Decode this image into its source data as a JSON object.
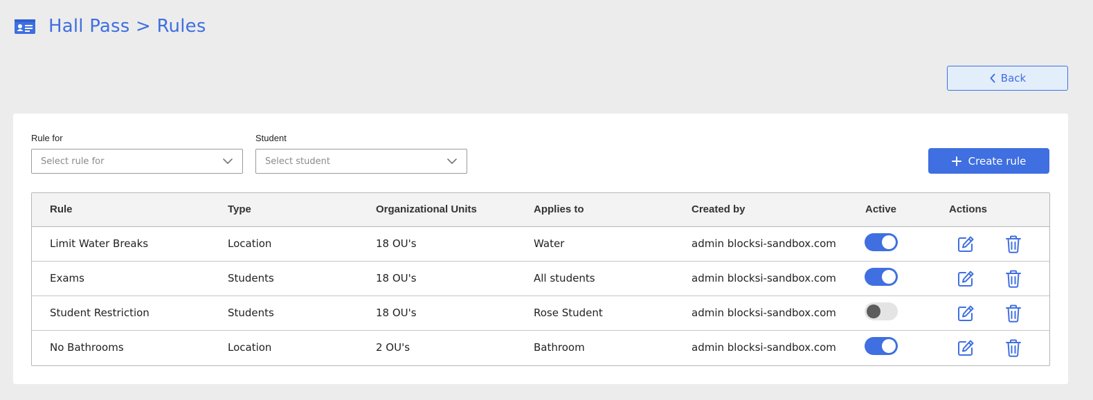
{
  "header": {
    "icon": "id-card-icon",
    "title": "Hall Pass > Rules"
  },
  "back_button": {
    "icon": "chevron-left-icon",
    "label": "Back"
  },
  "filters": {
    "rule_for": {
      "label": "Rule for",
      "placeholder": "Select rule for"
    },
    "student": {
      "label": "Student",
      "placeholder": "Select student"
    }
  },
  "create_button": {
    "icon": "plus-icon",
    "label": "Create rule"
  },
  "table": {
    "columns": [
      "Rule",
      "Type",
      "Organizational Units",
      "Applies to",
      "Created by",
      "Active",
      "Actions"
    ],
    "rows": [
      {
        "rule": "Limit Water Breaks",
        "type": "Location",
        "ous": "18 OU's",
        "applies_to": "Water",
        "created_by": "admin blocksi-sandbox.com",
        "active": true
      },
      {
        "rule": "Exams",
        "type": "Students",
        "ous": "18 OU's",
        "applies_to": "All students",
        "created_by": "admin blocksi-sandbox.com",
        "active": true
      },
      {
        "rule": "Student Restriction",
        "type": "Students",
        "ous": "18 OU's",
        "applies_to": "Rose Student",
        "created_by": "admin blocksi-sandbox.com",
        "active": false
      },
      {
        "rule": "No Bathrooms",
        "type": "Location",
        "ous": "2 OU's",
        "applies_to": "Bathroom",
        "created_by": "admin blocksi-sandbox.com",
        "active": true
      }
    ],
    "action_icons": [
      "edit-icon",
      "trash-icon"
    ]
  },
  "colors": {
    "accent": "#3f6fe0",
    "background": "#ececec",
    "toggle_off": "#e4e4e4"
  }
}
